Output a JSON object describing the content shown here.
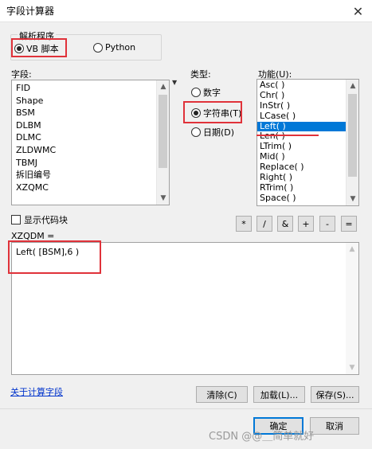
{
  "window": {
    "title": "字段计算器",
    "close_glyph": "✕"
  },
  "parser": {
    "group_title": "解析程序",
    "options": [
      {
        "label": "VB 脚本",
        "selected": true
      },
      {
        "label": "Python",
        "selected": false
      }
    ]
  },
  "fields": {
    "label": "字段:",
    "items": [
      "FID",
      "Shape",
      "BSM",
      "DLBM",
      "DLMC",
      "ZLDWMC",
      "TBMJ",
      "拆旧编号",
      "XZQMC"
    ]
  },
  "type": {
    "label": "类型:",
    "options": [
      {
        "label": "数字",
        "selected": false
      },
      {
        "label": "字符串(T)",
        "selected": true
      },
      {
        "label": "日期(D)",
        "selected": false
      }
    ]
  },
  "functions": {
    "label": "功能(U):",
    "items": [
      "Asc( )",
      "Chr( )",
      "InStr( )",
      "LCase( )",
      "Left( )",
      "Len( )",
      "LTrim( )",
      "Mid( )",
      "Replace( )",
      "Right( )",
      "RTrim( )",
      "Space( )"
    ],
    "selected_index": 4
  },
  "show_codeblock": {
    "label": "显示代码块",
    "checked": false
  },
  "operators": [
    "*",
    "/",
    "&",
    "+",
    "-",
    "="
  ],
  "expression": {
    "label": "XZQDM =",
    "value": "Left( [BSM],6 )"
  },
  "footer": {
    "about_link": "关于计算字段",
    "clear": "清除(C)",
    "load": "加载(L)...",
    "save": "保存(S)...",
    "ok": "确定",
    "cancel": "取消"
  },
  "watermark": "CSDN @@＿简单就好",
  "colors": {
    "highlight": "#e0323a",
    "selection": "#0078d7",
    "link": "#0033cc"
  },
  "icons": {
    "close": "close-icon",
    "scroll_up": "chevron-up-icon",
    "scroll_down": "chevron-down-icon"
  }
}
